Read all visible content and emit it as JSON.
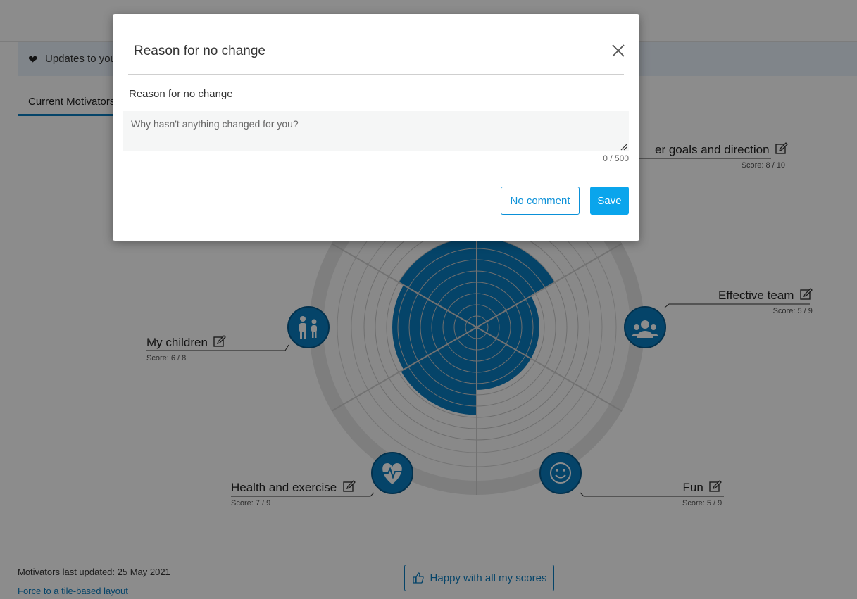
{
  "banner": {
    "icon": "heart-icon",
    "text": "Updates to you"
  },
  "tabs": [
    {
      "label": "Current Motivators"
    }
  ],
  "motivators": [
    {
      "name": "My children",
      "score_text": "Score: 6 / 8",
      "icon": "family-icon"
    },
    {
      "name": "Effective team",
      "score_text": "Score: 5 / 9",
      "icon": "team-icon"
    },
    {
      "name": "Health and exercise",
      "score_text": "Score: 7 / 9",
      "icon": "heart-pulse-icon"
    },
    {
      "name": "Fun",
      "score_text": "Score: 5 / 9",
      "icon": "smiley-icon"
    },
    {
      "name": "er goals and direction",
      "score_text": "Score: 8 / 10",
      "icon": ""
    }
  ],
  "wheel_segments": [
    {
      "score": 8,
      "max": 10
    },
    {
      "score": 5,
      "max": 9
    },
    {
      "score": 5,
      "max": 9
    },
    {
      "score": 7,
      "max": 9
    },
    {
      "score": 6,
      "max": 8
    },
    {
      "score": 8,
      "max": 10
    }
  ],
  "footer": {
    "updated_text": "Motivators last updated: 25 May 2021",
    "layout_link": "Force to a tile-based layout",
    "happy_button": "Happy with all my scores"
  },
  "modal": {
    "title": "Reason for no change",
    "field_label": "Reason for no change",
    "placeholder": "Why hasn't anything changed for you?",
    "counter": "0 / 500",
    "no_comment_label": "No comment",
    "save_label": "Save"
  },
  "colors": {
    "accent": "#0a7cc0",
    "wheel_fill": "#0a7cc0",
    "primary_button": "#0aa5ec",
    "overlay": "rgba(0,0,0,0.45)"
  }
}
